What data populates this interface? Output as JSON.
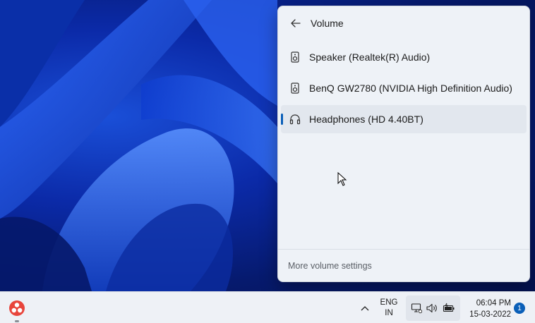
{
  "flyout": {
    "title": "Volume",
    "devices": [
      {
        "label": "Speaker (Realtek(R) Audio)",
        "icon": "speaker-icon",
        "selected": false
      },
      {
        "label": "BenQ GW2780 (NVIDIA High Definition Audio)",
        "icon": "speaker-icon",
        "selected": false
      },
      {
        "label": "Headphones (HD 4.40BT)",
        "icon": "headphones-icon",
        "selected": true
      }
    ],
    "footer_label": "More volume settings"
  },
  "taskbar": {
    "app_icon": "app-logo-icon",
    "language_line1": "ENG",
    "language_line2": "IN",
    "time": "06:04 PM",
    "date": "15-03-2022",
    "notification_count": "1"
  },
  "colors": {
    "accent": "#0a5fb8",
    "flyout_bg": "#eef2f7",
    "taskbar_bg": "#eef1f6"
  }
}
